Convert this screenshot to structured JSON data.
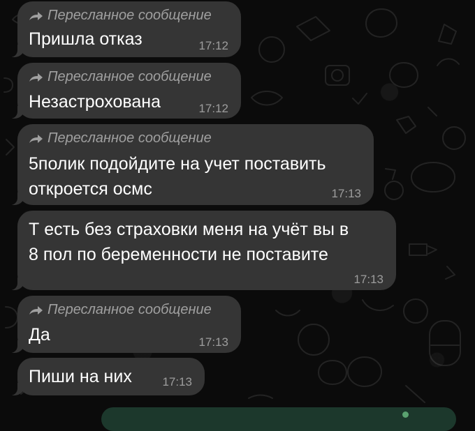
{
  "forward_label": "Пересланное сообщение",
  "icons": {
    "forward": "forward-arrow-icon",
    "bottom_bar": "status-dot-icon"
  },
  "colors": {
    "background": "#0b0b0b",
    "bubble": "#353535",
    "forward_label": "#a0a0a0",
    "message_text": "#ffffff",
    "time": "#9d9d9d",
    "bottom_bar": "#1c382c"
  },
  "messages": [
    {
      "forwarded": true,
      "text": "Пришла отказ",
      "time": "17:12"
    },
    {
      "forwarded": true,
      "text": "Незастрохована",
      "time": "17:12"
    },
    {
      "forwarded": true,
      "text": "5полик подойдите на учет поставить\nоткроется осмс",
      "time": "17:13"
    },
    {
      "forwarded": false,
      "text": "Т есть без страховки меня на учёт вы в\n8 пол по беременности не поставите",
      "time": "17:13"
    },
    {
      "forwarded": true,
      "text": "Да",
      "time": "17:13"
    },
    {
      "forwarded": false,
      "text": "Пиши на них",
      "time": "17:13"
    }
  ]
}
